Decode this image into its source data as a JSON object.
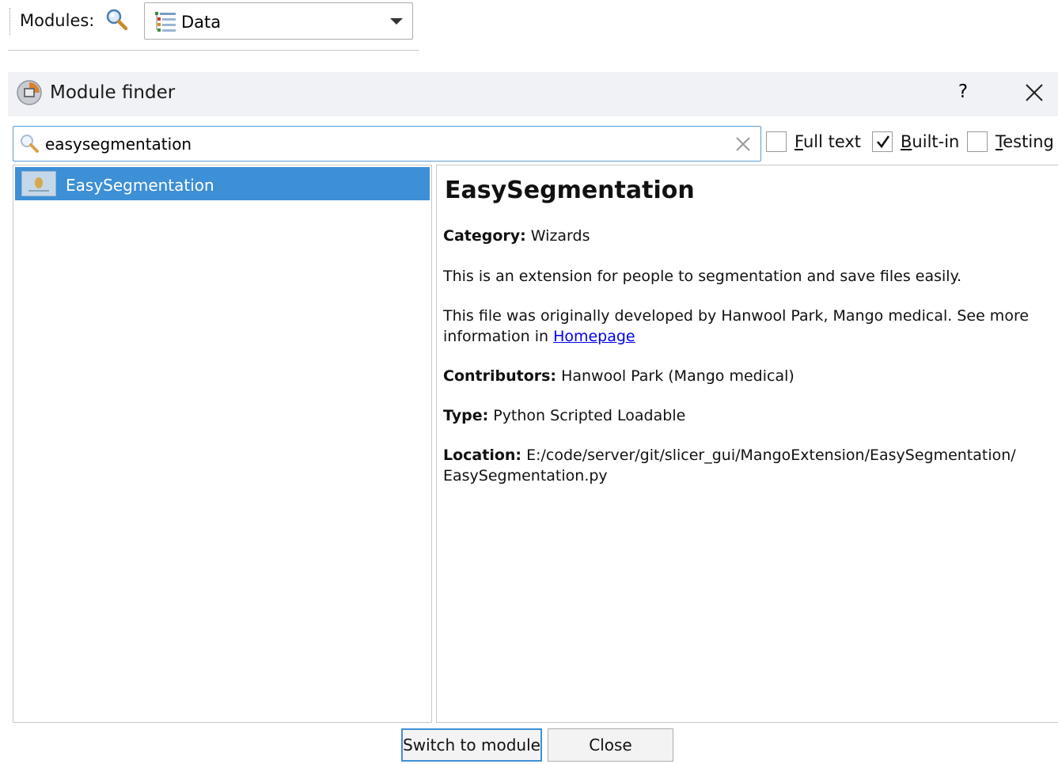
{
  "toolbar": {
    "modules_label": "Modules:",
    "selected_module": "Data"
  },
  "dialog": {
    "title": "Module finder",
    "help_label": "?",
    "search": {
      "value": "easysegmentation",
      "placeholder": ""
    },
    "options": {
      "full_text": {
        "label_access": "F",
        "label_rest": "ull text",
        "checked": false
      },
      "built_in": {
        "label_access": "B",
        "label_rest": "uilt-in",
        "checked": true
      },
      "testing": {
        "label_access": "T",
        "label_rest": "esting",
        "checked": false
      }
    },
    "results": [
      {
        "label": "EasySegmentation",
        "selected": true
      }
    ],
    "details": {
      "name": "EasySegmentation",
      "category_label": "Category:",
      "category_value": "Wizards",
      "description": "This is an extension for people to segmentation and save files easily.",
      "acknowledgement_line1": "This file was originally developed by Hanwool Park, Mango medical. See more",
      "acknowledgement_line2_prefix": "information in ",
      "homepage_link": "Homepage",
      "contributors_label": "Contributors:",
      "contributors_value": "Hanwool Park (Mango medical)",
      "type_label": "Type:",
      "type_value": "Python Scripted Loadable",
      "location_label": "Location:",
      "location_line1": "E:/code/server/git/slicer_gui/MangoExtension/EasySegmentation/",
      "location_line2": "EasySegmentation.py"
    },
    "buttons": {
      "switch": "Switch to module",
      "close": "Close"
    }
  },
  "icons": {
    "modules_search": "magnifier-icon",
    "module_select": "data-module-icon",
    "dropdown": "chevron-down-icon",
    "title": "slicer-logo-icon",
    "close": "close-icon",
    "search": "search-icon",
    "clear": "clear-icon",
    "checkmark": "checkmark-icon",
    "result": "module-thumbnail-icon"
  },
  "colors": {
    "selection": "#3d8fd6",
    "link": "#0000ee",
    "focus_border": "#5b9bd5",
    "title_bar": "#f0f2f5"
  }
}
